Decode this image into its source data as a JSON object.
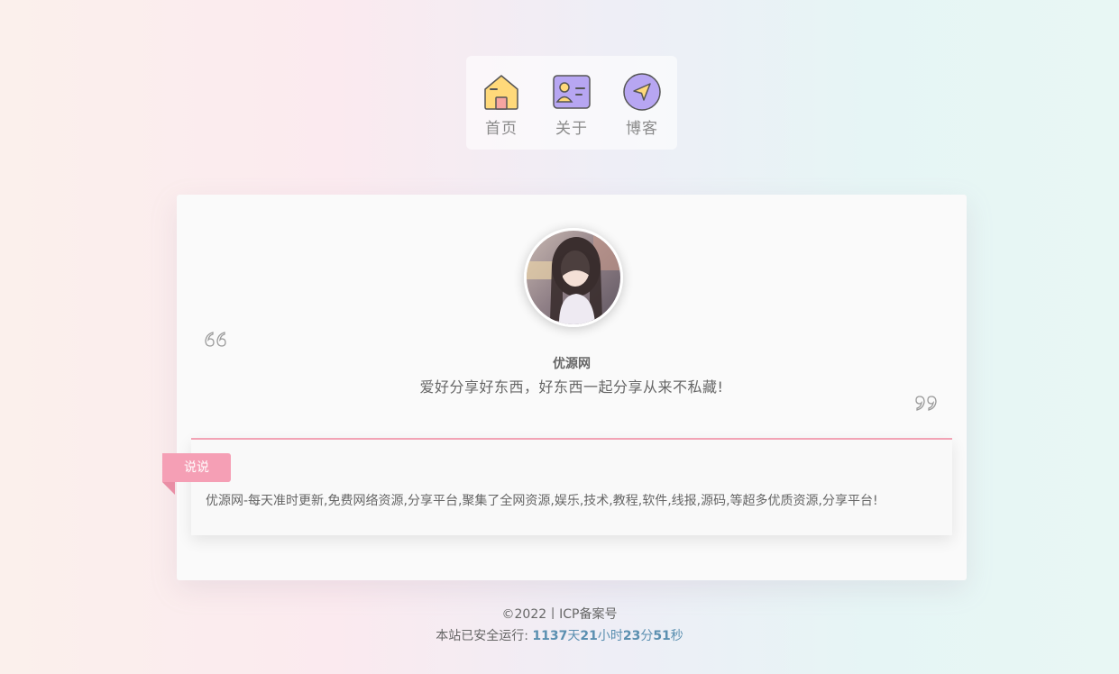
{
  "nav": {
    "items": [
      {
        "label": "首页",
        "icon": "home-icon"
      },
      {
        "label": "关于",
        "icon": "id-card-icon"
      },
      {
        "label": "博客",
        "icon": "send-icon"
      }
    ]
  },
  "profile": {
    "avatar": "avatar-photo",
    "name": "优源网",
    "motto": "爱好分享好东西，好东西一起分享从来不私藏!"
  },
  "shuoshuo": {
    "tag": "说说",
    "text": "优源网-每天准时更新,免费网络资源,分享平台,聚集了全网资源,娱乐,技术,教程,软件,线报,源码,等超多优质资源,分享平台!"
  },
  "footer": {
    "copyright": "©2022丨ICP备案号",
    "runtime_label": "本站已安全运行: ",
    "days": "1137",
    "days_unit": "天",
    "hours": "21",
    "hours_unit": "小时",
    "minutes": "23",
    "minutes_unit": "分",
    "seconds": "51",
    "seconds_unit": "秒"
  },
  "colors": {
    "accent_pink": "#f59fb5",
    "runtime_blue": "#5a8fb0"
  }
}
